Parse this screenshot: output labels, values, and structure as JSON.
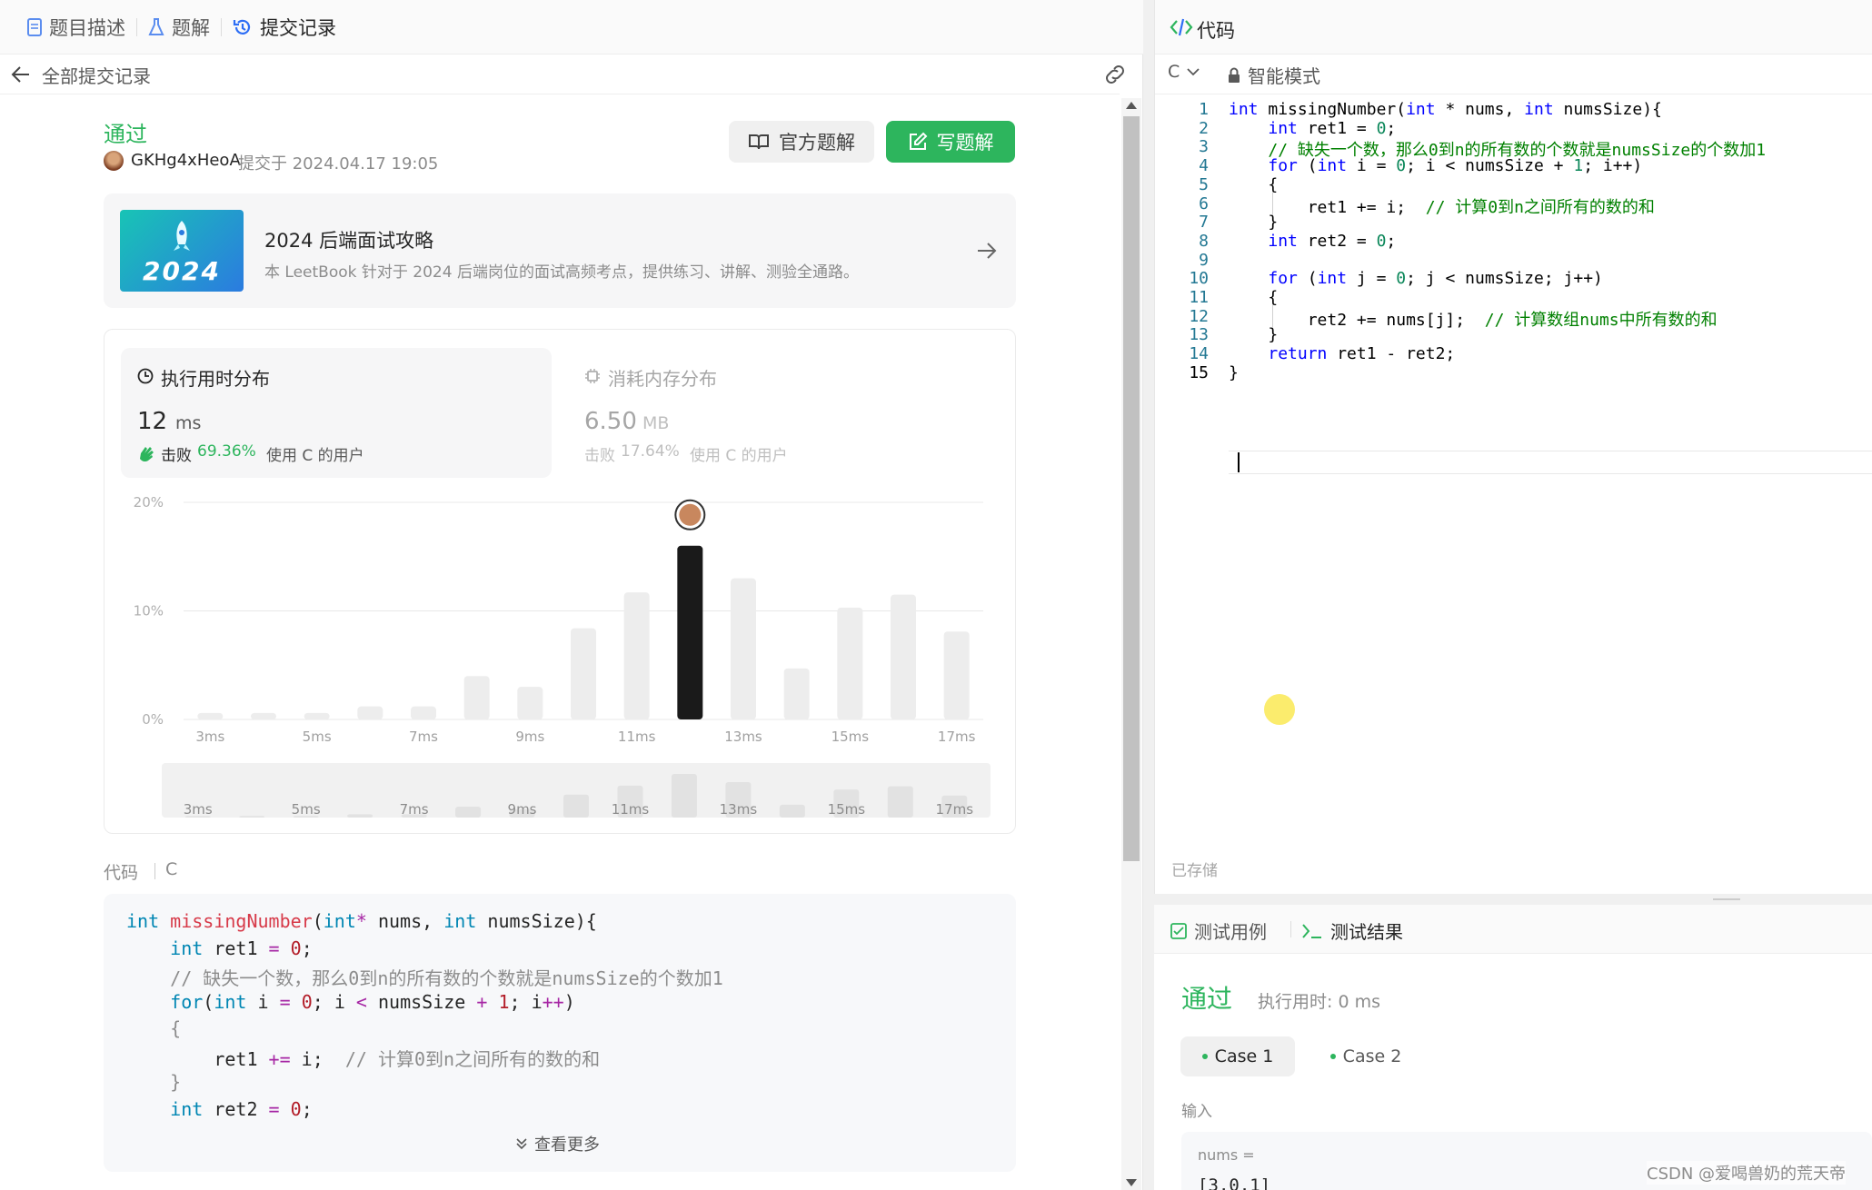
{
  "tabs": [
    {
      "label": "题目描述",
      "icon": "document-icon"
    },
    {
      "label": "题解",
      "icon": "flask-icon"
    },
    {
      "label": "提交记录",
      "icon": "history-icon"
    }
  ],
  "subheader": {
    "back_label": "全部提交记录"
  },
  "result": {
    "status": "通过",
    "user": "GKHg4xHeoA",
    "submitted": "提交于 2024.04.17 19:05",
    "status_color": "#2db55d"
  },
  "buttons": {
    "official": "官方题解",
    "write": "写题解"
  },
  "banner": {
    "badge": "2024",
    "title": "2024 后端面试攻略",
    "desc": "本 LeetBook 针对于 2024 后端岗位的面试高频考点，提供练习、讲解、测验全通路。"
  },
  "stats": {
    "time": {
      "label": "执行用时分布",
      "value": "12",
      "unit": "ms",
      "beat_prefix": "击败",
      "beat": "69.36%",
      "beat_suffix": "使用 C 的用户"
    },
    "memory": {
      "label": "消耗内存分布",
      "value": "6.50",
      "unit": "MB",
      "beat_prefix": "击败",
      "beat": "17.64%",
      "beat_suffix": "使用 C 的用户"
    }
  },
  "chart_data": {
    "type": "bar",
    "categories": [
      "3ms",
      "4ms",
      "5ms",
      "6ms",
      "7ms",
      "8ms",
      "9ms",
      "10ms",
      "11ms",
      "12ms",
      "13ms",
      "14ms",
      "15ms",
      "16ms",
      "17ms"
    ],
    "values": [
      0.6,
      0.6,
      0.6,
      1.2,
      1.2,
      4.0,
      3.0,
      8.4,
      11.7,
      16.0,
      13.0,
      4.7,
      10.3,
      11.5,
      8.1
    ],
    "highlight": "12ms",
    "ylim": [
      0,
      20
    ],
    "yticks": [
      "0%",
      "10%",
      "20%"
    ],
    "xticks": [
      "3ms",
      "5ms",
      "7ms",
      "9ms",
      "11ms",
      "13ms",
      "15ms",
      "17ms"
    ],
    "grid": true
  },
  "code_section": {
    "label": "代码",
    "lang": "C",
    "more": "查看更多"
  },
  "editor": {
    "title": "代码",
    "lang": "C",
    "mode": "智能模式",
    "saved": "已存储"
  },
  "code_lines": [
    [
      [
        "kw",
        "int"
      ],
      [
        "",
        "missingNumber("
      ],
      [
        "kw",
        "int"
      ],
      [
        "",
        "* nums, "
      ],
      [
        "kw",
        "int"
      ],
      [
        "",
        "numsSize){"
      ]
    ],
    [
      [
        "",
        "    "
      ],
      [
        "kw",
        "int"
      ],
      [
        "",
        "ret1 = "
      ],
      [
        "nm",
        "0"
      ],
      [
        "",
        ";"
      ]
    ],
    [
      [
        "",
        "    "
      ],
      [
        "cm",
        "// 缺失一个数，那么0到n的所有数的个数就是numsSize的个数加1"
      ]
    ],
    [
      [
        "",
        "    "
      ],
      [
        "kw",
        "for"
      ],
      [
        "",
        "("
      ],
      [
        "kw",
        "int"
      ],
      [
        "",
        "i = "
      ],
      [
        "nm",
        "0"
      ],
      [
        "",
        "; i < numsSize + "
      ],
      [
        "nm",
        "1"
      ],
      [
        "",
        "; i++)"
      ]
    ],
    [
      [
        "",
        "    {"
      ]
    ],
    [
      [
        "",
        "        ret1 += i;  "
      ],
      [
        "cm",
        "// 计算0到n之间所有的数的和"
      ]
    ],
    [
      [
        "",
        "    }"
      ]
    ],
    [
      [
        "",
        "    "
      ],
      [
        "kw",
        "int"
      ],
      [
        "",
        "ret2 = "
      ],
      [
        "nm",
        "0"
      ],
      [
        "",
        ";"
      ]
    ],
    [
      [
        "",
        ""
      ]
    ],
    [
      [
        "",
        "    "
      ],
      [
        "kw",
        "for"
      ],
      [
        "",
        "("
      ],
      [
        "kw",
        "int"
      ],
      [
        "",
        "j = "
      ],
      [
        "nm",
        "0"
      ],
      [
        "",
        "; j < numsSize; j++)"
      ]
    ],
    [
      [
        "",
        "    {"
      ]
    ],
    [
      [
        "",
        "        ret2 += nums[j];  "
      ],
      [
        "cm",
        "// 计算数组nums中所有数的和"
      ]
    ],
    [
      [
        "",
        "    }"
      ]
    ],
    [
      [
        "",
        "    "
      ],
      [
        "kw",
        "return"
      ],
      [
        "",
        "ret1 - ret2;"
      ]
    ],
    [
      [
        "",
        "}"
      ]
    ]
  ],
  "preview_lines": [
    [
      [
        "k2",
        "int"
      ],
      [
        "",
        " "
      ],
      [
        "fn",
        "missingNumber"
      ],
      [
        "",
        "("
      ],
      [
        "k2",
        "int"
      ],
      [
        "op",
        "*"
      ],
      [
        "",
        " nums, "
      ],
      [
        "k2",
        "int"
      ],
      [
        "",
        " numsSize){"
      ]
    ],
    [
      [
        "",
        "    "
      ],
      [
        "k2",
        "int"
      ],
      [
        "",
        " ret1 "
      ],
      [
        "op",
        "="
      ],
      [
        "",
        " "
      ],
      [
        "n2",
        "0"
      ],
      [
        "",
        ";"
      ]
    ],
    [
      [
        "",
        "    "
      ],
      [
        "gray",
        "// 缺失一个数，那么0到n的所有数的个数就是numsSize的个数加1"
      ]
    ],
    [
      [
        "",
        "    "
      ],
      [
        "k2",
        "for"
      ],
      [
        "",
        "("
      ],
      [
        "k2",
        "int"
      ],
      [
        "",
        " i "
      ],
      [
        "op",
        "="
      ],
      [
        "",
        " "
      ],
      [
        "n2",
        "0"
      ],
      [
        "",
        "; i "
      ],
      [
        "op",
        "<"
      ],
      [
        "",
        " numsSize "
      ],
      [
        "op",
        "+"
      ],
      [
        "",
        " "
      ],
      [
        "n2",
        "1"
      ],
      [
        "",
        "; i"
      ],
      [
        "op",
        "++"
      ],
      [
        "",
        ")"
      ]
    ],
    [
      [
        "gray",
        "    {"
      ]
    ],
    [
      [
        "",
        "        ret1 "
      ],
      [
        "op",
        "+="
      ],
      [
        "",
        " i;  "
      ],
      [
        "gray",
        "// 计算0到n之间所有的数的和"
      ]
    ],
    [
      [
        "gray",
        "    }"
      ]
    ],
    [
      [
        "",
        "    "
      ],
      [
        "k2",
        "int"
      ],
      [
        "",
        " ret2 "
      ],
      [
        "op",
        "="
      ],
      [
        "",
        " "
      ],
      [
        "n2",
        "0"
      ],
      [
        "",
        ";"
      ]
    ]
  ],
  "test": {
    "tab1": "测试用例",
    "tab2": "测试结果",
    "status": "通过",
    "runtime": "执行用时: 0 ms",
    "cases": [
      "Case 1",
      "Case 2"
    ],
    "input_label": "输入",
    "var": "nums =",
    "val": "[3,0,1]"
  },
  "watermark": "CSDN @爱喝兽奶的荒天帝"
}
